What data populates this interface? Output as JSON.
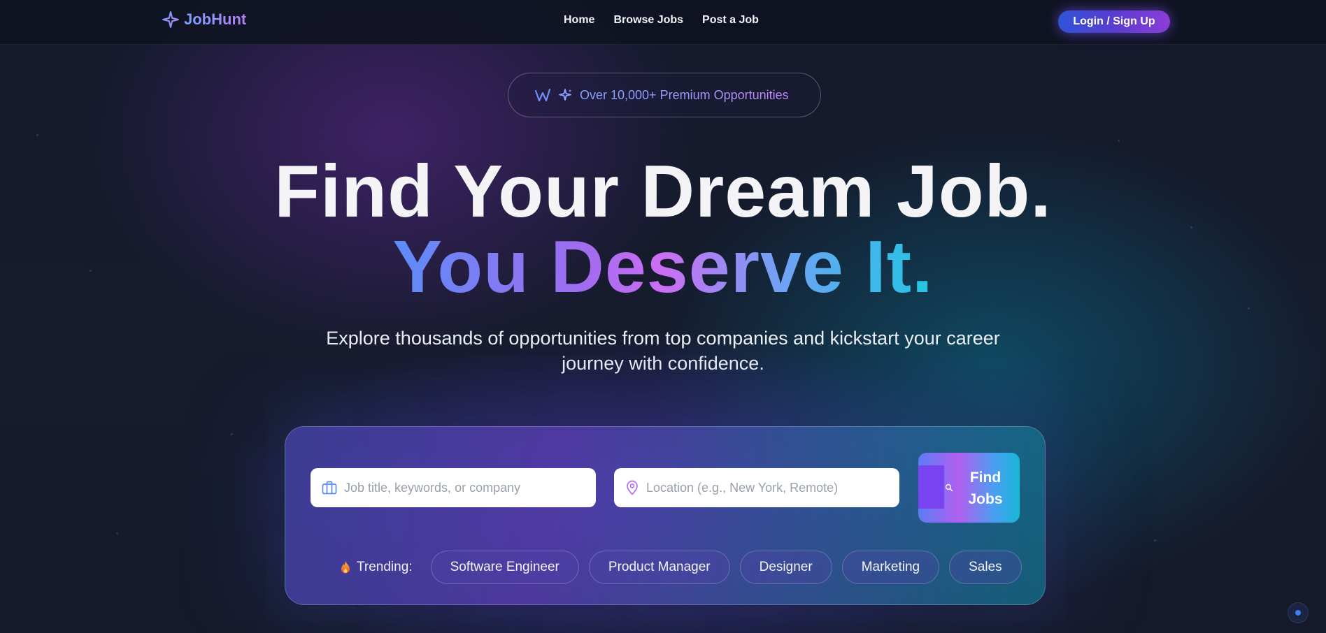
{
  "nav": {
    "brand": "JobHunt",
    "links": [
      "Home",
      "Browse Jobs",
      "Post a Job"
    ],
    "login_label": "Login / Sign Up"
  },
  "badge": {
    "text": "Over 10,000+ Premium Opportunities"
  },
  "hero": {
    "line1": "Find Your Dream Job.",
    "line2": "You Deserve It.",
    "subtitle": "Explore thousands of opportunities from top companies and kickstart your career journey with confidence."
  },
  "search": {
    "keyword_placeholder": "Job title, keywords, or company",
    "location_placeholder": "Location (e.g., New York, Remote)",
    "button_label": "Find Jobs"
  },
  "trending": {
    "label": "Trending:",
    "tags": [
      "Software Engineer",
      "Product Manager",
      "Designer",
      "Marketing",
      "Sales"
    ]
  },
  "colors": {
    "accent_blue": "#5c8cf7",
    "accent_purple": "#b25ff0",
    "accent_cyan": "#22c6e2",
    "background": "#151a2b"
  }
}
